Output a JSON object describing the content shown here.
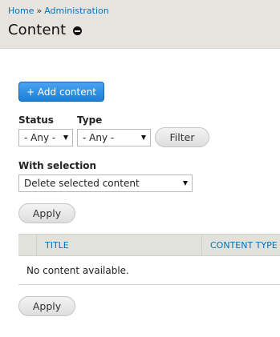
{
  "breadcrumb": {
    "home": "Home",
    "separator": "»",
    "admin": "Administration"
  },
  "page": {
    "title": "Content"
  },
  "actions": {
    "add_content": "+ Add content"
  },
  "filters": {
    "status_label": "Status",
    "status_value": "- Any -",
    "type_label": "Type",
    "type_value": "- Any -",
    "filter_button": "Filter"
  },
  "bulk": {
    "label": "With selection",
    "selected_action": "Delete selected content",
    "apply_top": "Apply",
    "apply_bottom": "Apply"
  },
  "table": {
    "columns": [
      "TITLE",
      "CONTENT TYPE"
    ],
    "empty_message": "No content available."
  },
  "colors": {
    "link": "#0074bd",
    "primary_button": "#1b7fd7",
    "header_bg": "#e7e4df"
  }
}
